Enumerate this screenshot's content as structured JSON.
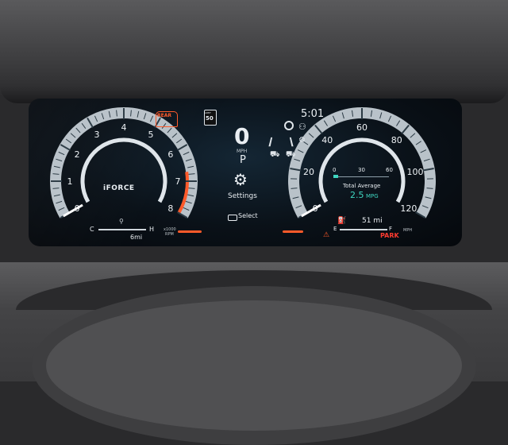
{
  "tach": {
    "ticks": [
      "0",
      "1",
      "2",
      "3",
      "4",
      "5",
      "6",
      "7",
      "8"
    ],
    "unit_line1": "x1000",
    "unit_line2": "RPM",
    "logo": "iFORCE",
    "temp_cold": "C",
    "temp_hot": "H",
    "odo": "6mi"
  },
  "center": {
    "time": "5:01",
    "speed": "0",
    "speed_unit": "MPH",
    "gear": "P",
    "rear_label": "REAR",
    "speed_limit_line1": "LIMIT",
    "speed_limit_value": "50",
    "settings_label": "Settings",
    "select_label": "Select"
  },
  "speedo": {
    "ticks": [
      "0",
      "20",
      "40",
      "60",
      "80",
      "100",
      "120"
    ],
    "unit": "MPH",
    "bar_ticks": [
      "0",
      "30",
      "60"
    ],
    "avg_title": "Total Average",
    "avg_value": "2.5",
    "avg_unit": "MPG",
    "fuel_empty": "E",
    "fuel_full": "F",
    "range": "51 mi",
    "park": "PARK"
  },
  "colors": {
    "accent_orange": "#ff5a2a",
    "teal": "#3fd6c0",
    "park_red": "#ff3b30",
    "gauge_white": "#dfe5ea"
  }
}
